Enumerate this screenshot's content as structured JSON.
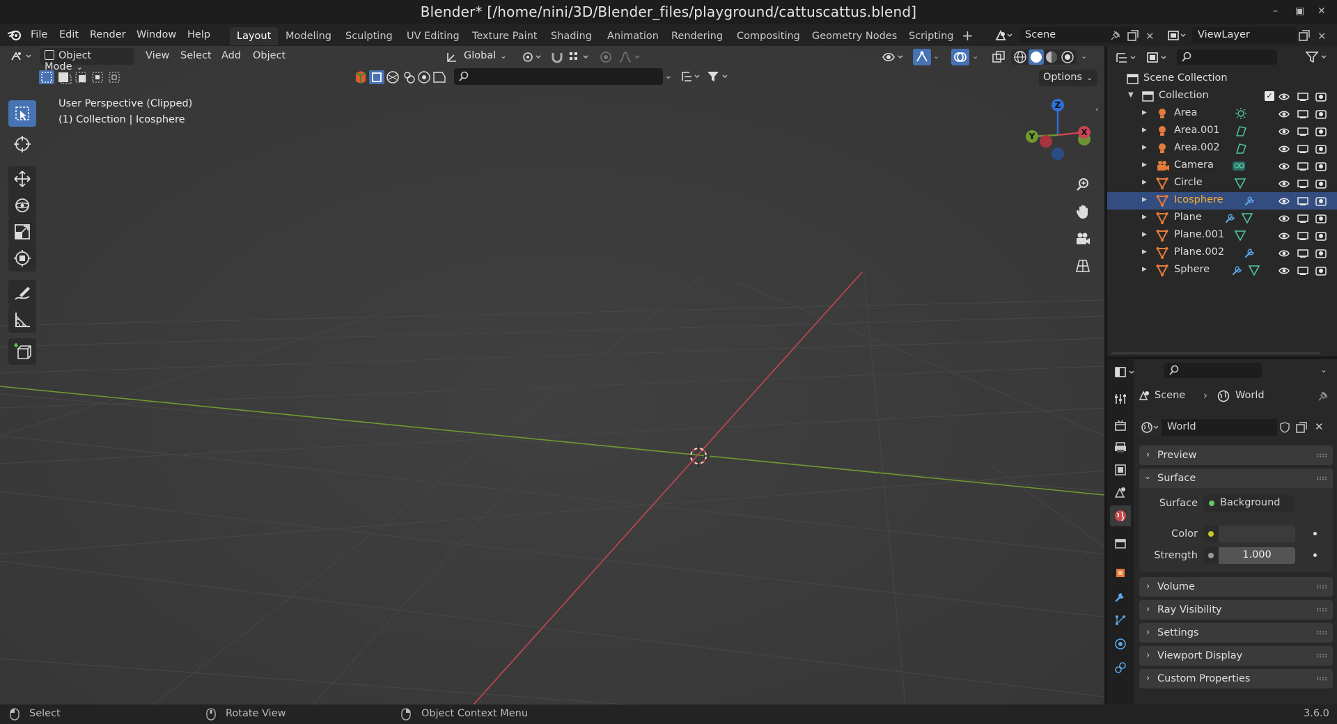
{
  "window": {
    "title": "Blender* [/home/nini/3D/Blender_files/playground/cattuscattus.blend]"
  },
  "menu": [
    "File",
    "Edit",
    "Render",
    "Window",
    "Help"
  ],
  "workspaces": [
    "Layout",
    "Modeling",
    "Sculpting",
    "UV Editing",
    "Texture Paint",
    "Shading",
    "Animation",
    "Rendering",
    "Compositing",
    "Geometry Nodes",
    "Scripting"
  ],
  "active_workspace": "Layout",
  "scene": {
    "name": "Scene",
    "view_layer": "ViewLayer"
  },
  "viewport": {
    "mode": "Object Mode",
    "menus": [
      "View",
      "Select",
      "Add",
      "Object"
    ],
    "transform_orientation": "Global",
    "options_label": "Options",
    "info_line1": "User Perspective (Clipped)",
    "info_line2": "(1) Collection | Icosphere",
    "gizmo_axes": {
      "x": "X",
      "y": "Y",
      "z": "Z"
    },
    "colors": {
      "x_axis": "#c94452",
      "y_axis": "#6e9a2e",
      "z_axis": "#2f6fd3",
      "accent": "#4772b3"
    }
  },
  "outliner": {
    "scene_collection": "Scene Collection",
    "collection": "Collection",
    "objects": [
      {
        "name": "Area",
        "type_icon": "light-icon",
        "data_icon": "sun-light-data-icon",
        "selected": false
      },
      {
        "name": "Area.001",
        "type_icon": "light-icon",
        "data_icon": "spot-light-data-icon",
        "selected": false
      },
      {
        "name": "Area.002",
        "type_icon": "light-icon",
        "data_icon": "spot-light-data-icon",
        "selected": false
      },
      {
        "name": "Camera",
        "type_icon": "camera-icon",
        "data_icon": "camera-data-icon",
        "selected": false
      },
      {
        "name": "Circle",
        "type_icon": "mesh-icon",
        "data_icon": "mesh-data-icon",
        "selected": false
      },
      {
        "name": "Icosphere",
        "type_icon": "mesh-icon",
        "data_icon": "wrench-modifier-icon",
        "selected": true
      },
      {
        "name": "Plane",
        "type_icon": "mesh-icon",
        "data_icon": "wrench-modifier-icon",
        "selected": false
      },
      {
        "name": "Plane.001",
        "type_icon": "mesh-icon",
        "data_icon": "mesh-data-icon",
        "selected": false
      },
      {
        "name": "Plane.002",
        "type_icon": "mesh-icon",
        "data_icon": "wrench-modifier-icon",
        "selected": false
      },
      {
        "name": "Sphere",
        "type_icon": "mesh-icon",
        "data_icon": "wrench-modifier-icon",
        "selected": false
      }
    ]
  },
  "properties": {
    "breadcrumb": [
      "Scene",
      "World"
    ],
    "world_name": "World",
    "panels": {
      "preview": "Preview",
      "surface": "Surface",
      "volume": "Volume",
      "ray_visibility": "Ray Visibility",
      "settings": "Settings",
      "viewport_display": "Viewport Display",
      "custom_properties": "Custom Properties"
    },
    "fields": {
      "surface_label": "Surface",
      "surface_value": "Background",
      "color_label": "Color",
      "strength_label": "Strength",
      "strength_value": "1.000"
    }
  },
  "statusbar": {
    "select": "Select",
    "rotate": "Rotate View",
    "context": "Object Context Menu",
    "version": "3.6.0"
  }
}
